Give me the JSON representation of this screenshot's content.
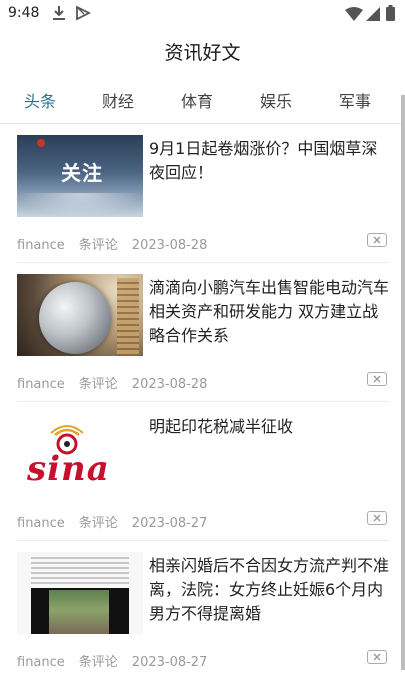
{
  "status_bar": {
    "time": "9:48"
  },
  "app": {
    "title": "资讯好文"
  },
  "tabs": [
    {
      "label": "头条",
      "active": true
    },
    {
      "label": "财经",
      "active": false
    },
    {
      "label": "体育",
      "active": false
    },
    {
      "label": "娱乐",
      "active": false
    },
    {
      "label": "军事",
      "active": false
    }
  ],
  "articles": [
    {
      "headline": "9月1日起卷烟涨价？中国烟草深夜回应！",
      "source": "finance",
      "comments_label": "条评论",
      "date": "2023-08-28",
      "thumb_text": "关注"
    },
    {
      "headline": "滴滴向小鹏汽车出售智能电动汽车相关资产和研发能力 双方建立战略合作关系",
      "source": "finance",
      "comments_label": "条评论",
      "date": "2023-08-28"
    },
    {
      "headline": "明起印花税减半征收",
      "source": "finance",
      "comments_label": "条评论",
      "date": "2023-08-27",
      "thumb_text": "sina"
    },
    {
      "headline": "相亲闪婚后不合因女方流产判不准离，法院：女方终止妊娠6个月内男方不得提离婚",
      "source": "finance",
      "comments_label": "条评论",
      "date": "2023-08-27"
    }
  ],
  "colors": {
    "active_tab": "#2a6f97",
    "meta_text": "#9a9a9a",
    "sina_red": "#c8102e"
  }
}
